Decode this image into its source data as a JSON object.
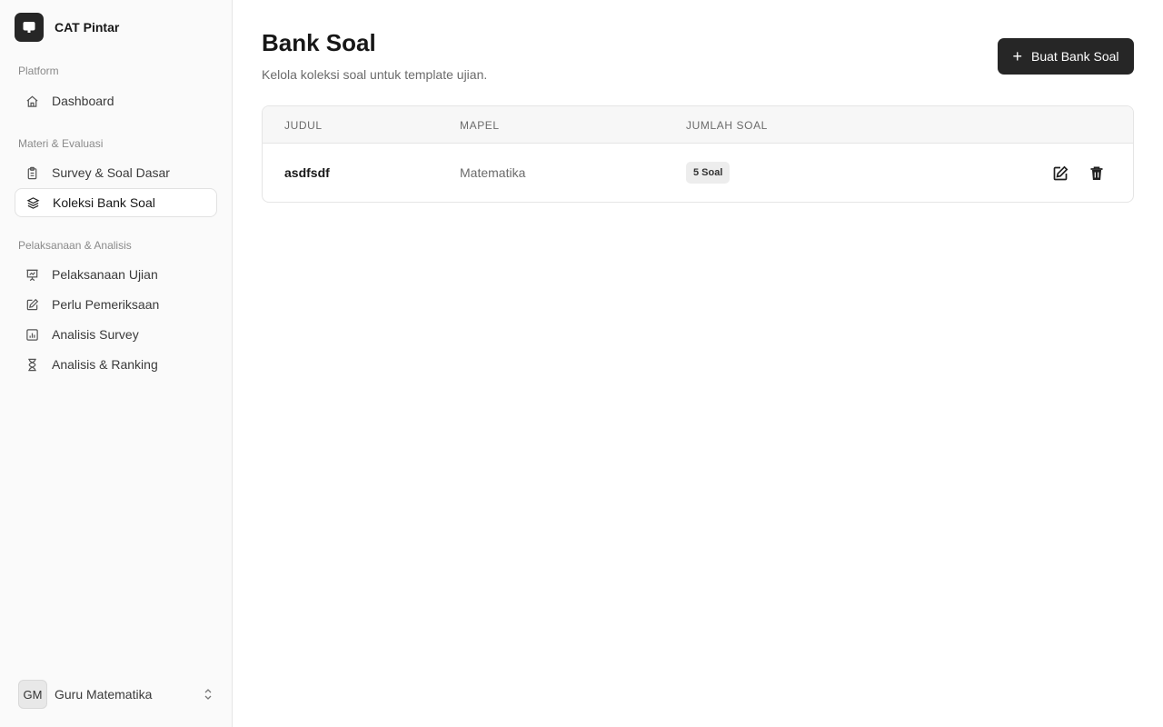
{
  "brand": {
    "name": "CAT Pintar",
    "icon": "monitor-icon"
  },
  "sidebar": {
    "groups": [
      {
        "label": "Platform"
      },
      {
        "label": "Materi & Evaluasi"
      },
      {
        "label": "Pelaksanaan & Analisis"
      }
    ],
    "items": [
      {
        "label": "Dashboard",
        "icon": "home-icon"
      },
      {
        "label": "Survey & Soal Dasar",
        "icon": "clipboard-icon"
      },
      {
        "label": "Koleksi Bank Soal",
        "icon": "layers-icon",
        "active": true
      },
      {
        "label": "Pelaksanaan Ujian",
        "icon": "presentation-icon"
      },
      {
        "label": "Perlu Pemeriksaan",
        "icon": "pencil-icon"
      },
      {
        "label": "Analisis Survey",
        "icon": "bar-chart-icon"
      },
      {
        "label": "Analisis & Ranking",
        "icon": "hourglass-icon"
      }
    ]
  },
  "user": {
    "initials": "GM",
    "name": "Guru Matematika"
  },
  "main": {
    "title": "Bank Soal",
    "subtitle": "Kelola koleksi soal untuk template ujian.",
    "create_button": "Buat Bank Soal"
  },
  "table": {
    "headers": [
      "JUDUL",
      "MAPEL",
      "JUMLAH SOAL"
    ],
    "rows": [
      {
        "judul": "asdfsdf",
        "mapel": "Matematika",
        "jumlah": "5 Soal"
      }
    ]
  },
  "colors": {
    "accent": "#262626",
    "sidebar_bg": "#fafafa",
    "border": "#e5e5e5"
  }
}
